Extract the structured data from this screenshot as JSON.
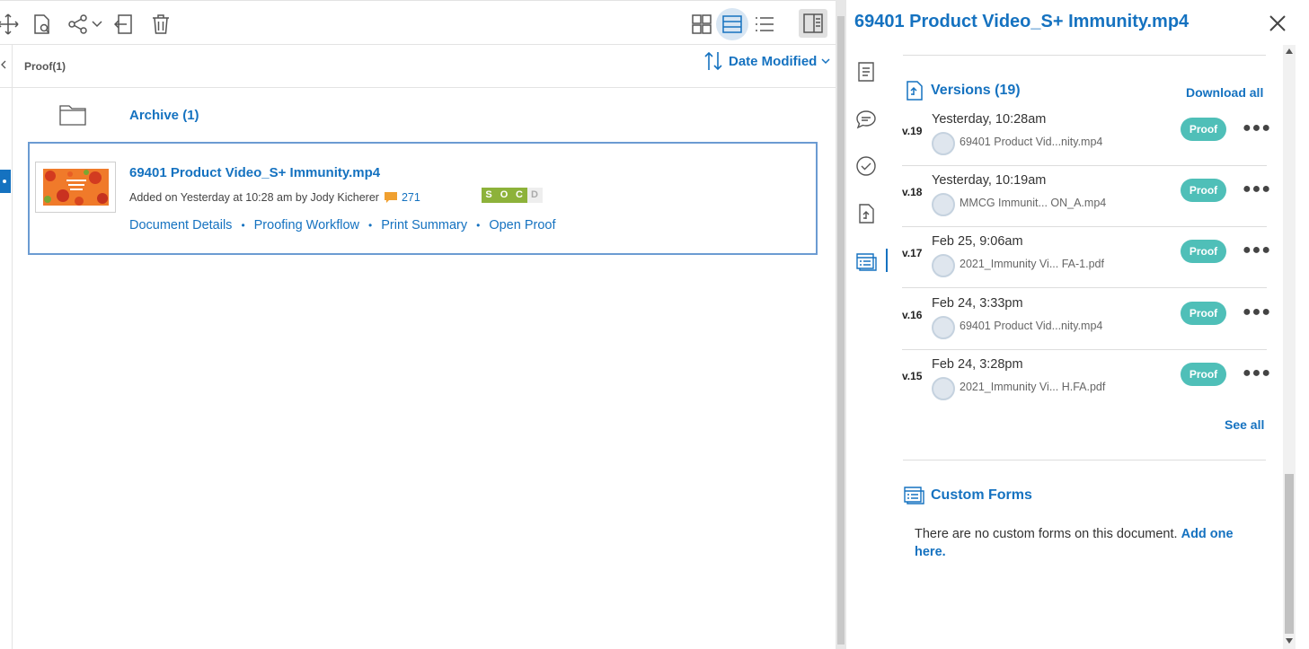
{
  "toolbar": {
    "icons": [
      "move-icon",
      "search-document-icon",
      "share-icon",
      "chevron-down-icon",
      "exit-icon",
      "trash-icon",
      "grid-view-icon",
      "detail-view-icon",
      "list-view-icon",
      "panel-toggle-icon"
    ]
  },
  "breadcrumb": "Proof(1)",
  "sort": {
    "label": "Date Modified"
  },
  "folder": {
    "label": "Archive (1)"
  },
  "document": {
    "title": "69401 Product Video_S+ Immunity.mp4",
    "meta": "Added on Yesterday at 10:28 am by Jody Kicherer",
    "comment_count": "271",
    "status": [
      "S",
      "O",
      "C",
      "D"
    ],
    "links": [
      "Document Details",
      "Proofing Workflow",
      "Print Summary",
      "Open Proof"
    ]
  },
  "panel": {
    "title": "69401 Product Video_S+ Immunity.mp4",
    "versions_title": "Versions (19)",
    "download_all": "Download all",
    "proof_label": "Proof",
    "versions": [
      {
        "num": "v.19",
        "date": "Yesterday, 10:28am",
        "file": "69401 Product Vid...nity.mp4"
      },
      {
        "num": "v.18",
        "date": "Yesterday, 10:19am",
        "file": "MMCG Immunit... ON_A.mp4"
      },
      {
        "num": "v.17",
        "date": "Feb 25, 9:06am",
        "file": "2021_Immunity Vi...  FA-1.pdf"
      },
      {
        "num": "v.16",
        "date": "Feb 24, 3:33pm",
        "file": "69401 Product Vid...nity.mp4"
      },
      {
        "num": "v.15",
        "date": "Feb 24, 3:28pm",
        "file": "2021_Immunity Vi... H.FA.pdf"
      }
    ],
    "see_all": "See all",
    "forms_title": "Custom Forms",
    "forms_text": "There are no custom forms on this document.",
    "forms_link": "Add one here."
  },
  "colors": {
    "accent": "#1572c0",
    "proof_button": "#4fbfb8",
    "status_on": "#8db23a"
  }
}
